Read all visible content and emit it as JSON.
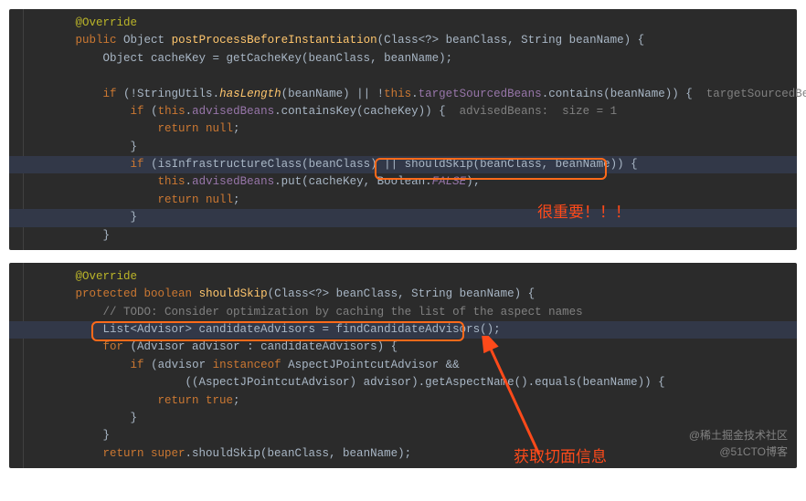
{
  "panel1": {
    "l1": "@Override",
    "l2a": "public",
    "l2b": "Object",
    "l2c": "postProcessBeforeInstantiation",
    "l2d": "(Class<?> beanClass, String beanName) {",
    "l3a": "Object cacheKey = getCacheKey(beanClass, beanName);",
    "l5a": "if",
    "l5b": "(!StringUtils.",
    "l5c": "hasLength",
    "l5d": "(beanName) || !",
    "l5e": "this",
    "l5f": ".",
    "l5g": "targetSourcedBeans",
    "l5h": ".contains(beanName)) {",
    "l5i": "  targetSourcedBeans:",
    "l6a": "if",
    "l6b": "(",
    "l6c": "this",
    "l6d": ".",
    "l6e": "advisedBeans",
    "l6f": ".containsKey(cacheKey)) {",
    "l6g": "  advisedBeans:  size = 1",
    "l7a": "return null",
    "l7b": ";",
    "l8": "}",
    "l9a": "if",
    "l9b": "(isInfrastructureClass(beanClass) || shouldSkip(beanClass, beanName)) {",
    "l10a": "this",
    "l10b": ".",
    "l10c": "advisedBeans",
    "l10d": ".put(cacheKey, Boolean.",
    "l10e": "FALSE",
    "l10f": ");",
    "l11a": "return null",
    "l11b": ";",
    "l12": "}",
    "l13": "}",
    "callout1": "很重要！！！"
  },
  "panel2": {
    "l1": "@Override",
    "l2a": "protected boolean",
    "l2b": "shouldSkip",
    "l2c": "(Class<?> beanClass, String beanName) {",
    "l3": "// TODO: Consider optimization by caching the list of the aspect names",
    "l4a": "List<Advisor> candidateAdvisors = findCandidateAdvisors();",
    "l5a": "for",
    "l5b": "(Advisor advisor : candidateAdvisors) {",
    "l6a": "if",
    "l6b": "(advisor ",
    "l6c": "instanceof",
    "l6d": " AspectJPointcutAdvisor &&",
    "l7a": "((AspectJPointcutAdvisor) advisor).getAspectName().equals(beanName)) {",
    "l8a": "return true",
    "l8b": ";",
    "l9": "}",
    "l10": "}",
    "l11a": "return super",
    "l11b": ".shouldSkip(beanClass, beanName);",
    "callout2": "获取切面信息"
  },
  "watermarks": {
    "w1": "@稀土掘金技术社区",
    "w2": "@51CTO博客"
  }
}
